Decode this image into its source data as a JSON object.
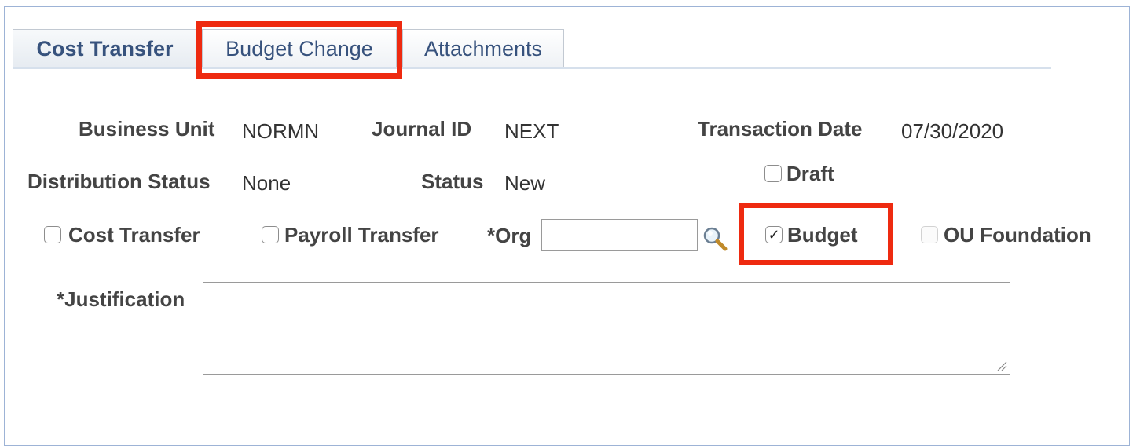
{
  "tabs": [
    {
      "label": "Cost Transfer",
      "active": true
    },
    {
      "label": "Budget Change",
      "active": false
    },
    {
      "label": "Attachments",
      "active": false
    }
  ],
  "fields": {
    "business_unit": {
      "label": "Business Unit",
      "value": "NORMN"
    },
    "journal_id": {
      "label": "Journal ID",
      "value": "NEXT"
    },
    "transaction_date": {
      "label": "Transaction Date",
      "value": "07/30/2020"
    },
    "distribution_status": {
      "label": "Distribution Status",
      "value": "None"
    },
    "status": {
      "label": "Status",
      "value": "New"
    }
  },
  "checkboxes": {
    "draft": {
      "label": "Draft",
      "checked": false
    },
    "cost_transfer": {
      "label": "Cost Transfer",
      "checked": false
    },
    "payroll_transfer": {
      "label": "Payroll Transfer",
      "checked": false
    },
    "budget": {
      "label": "Budget",
      "checked": true,
      "mark": "✓"
    },
    "ou_foundation": {
      "label": "OU Foundation",
      "checked": false,
      "disabled": true
    }
  },
  "org": {
    "label": "*Org",
    "value": "",
    "icon": "search-icon"
  },
  "justification": {
    "label": "*Justification",
    "value": ""
  },
  "colors": {
    "highlight": "#ee2a10",
    "tab_text": "#37527d",
    "frame_border": "#9db3d6"
  }
}
